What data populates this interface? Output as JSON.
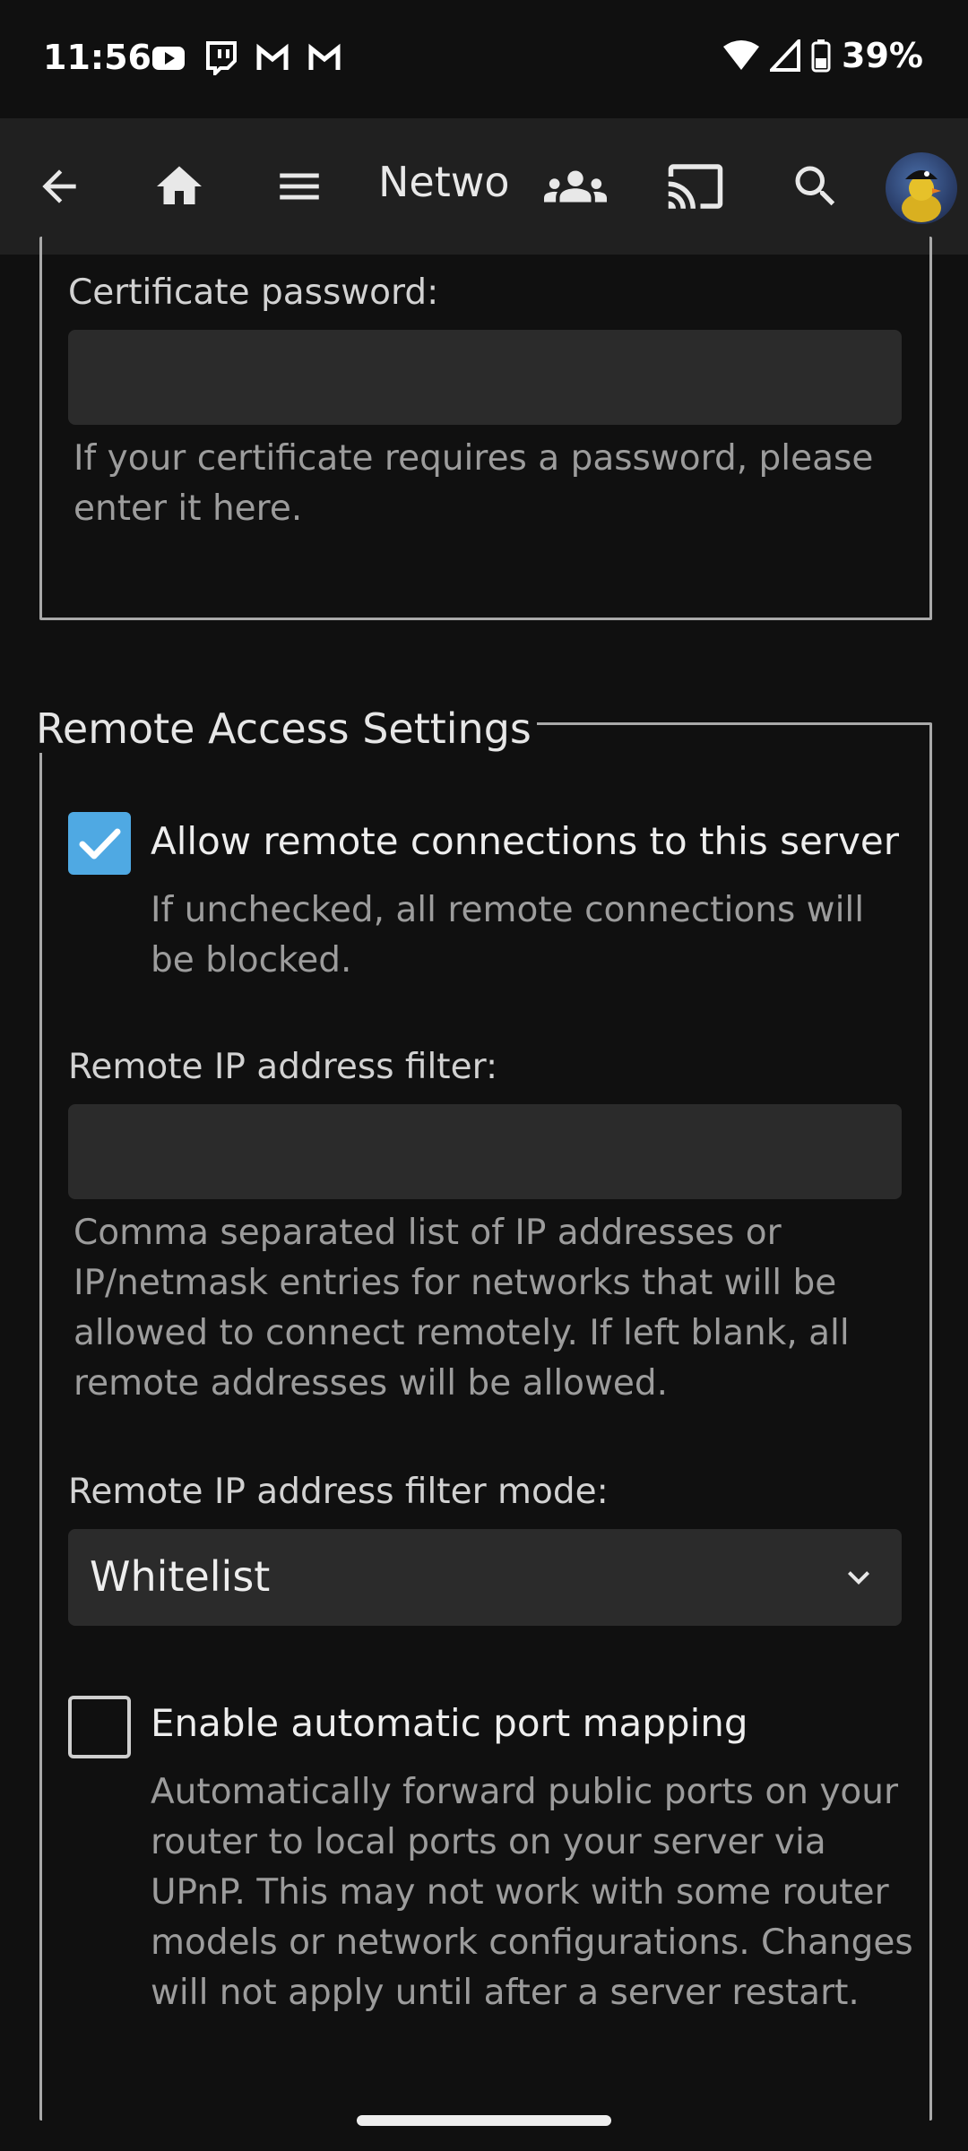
{
  "status_bar": {
    "time": "11:56",
    "battery": "39%",
    "notification_icons": [
      "youtube-icon",
      "twitch-icon",
      "gmail-icon",
      "gmail-icon"
    ]
  },
  "header": {
    "title": "Netwo",
    "icons": [
      "back-arrow-icon",
      "home-icon",
      "menu-icon",
      "users-icon",
      "cast-icon",
      "search-icon",
      "avatar"
    ]
  },
  "certificate_section": {
    "password_label": "Certificate password:",
    "password_value": "",
    "password_help": "If your certificate requires a password, please enter it here."
  },
  "remote_access": {
    "legend": "Remote Access Settings",
    "allow_remote": {
      "label": "Allow remote connections to this server",
      "checked": true,
      "help": "If unchecked, all remote connections will be blocked."
    },
    "ip_filter": {
      "label": "Remote IP address filter:",
      "value": "",
      "help": "Comma separated list of IP addresses or IP/netmask entries for networks that will be allowed to connect remotely. If left blank, all remote addresses will be allowed."
    },
    "filter_mode": {
      "label": "Remote IP address filter mode:",
      "selected": "Whitelist"
    },
    "port_mapping": {
      "label": "Enable automatic port mapping",
      "checked": false,
      "help": "Automatically forward public ports on your router to local ports on your server via UPnP. This may not work with some router models or network configurations. Changes will not apply until after a server restart."
    }
  },
  "colors": {
    "accent": "#4fa9e3",
    "background": "#101010",
    "header": "#202020",
    "input": "#2b2b2b"
  }
}
